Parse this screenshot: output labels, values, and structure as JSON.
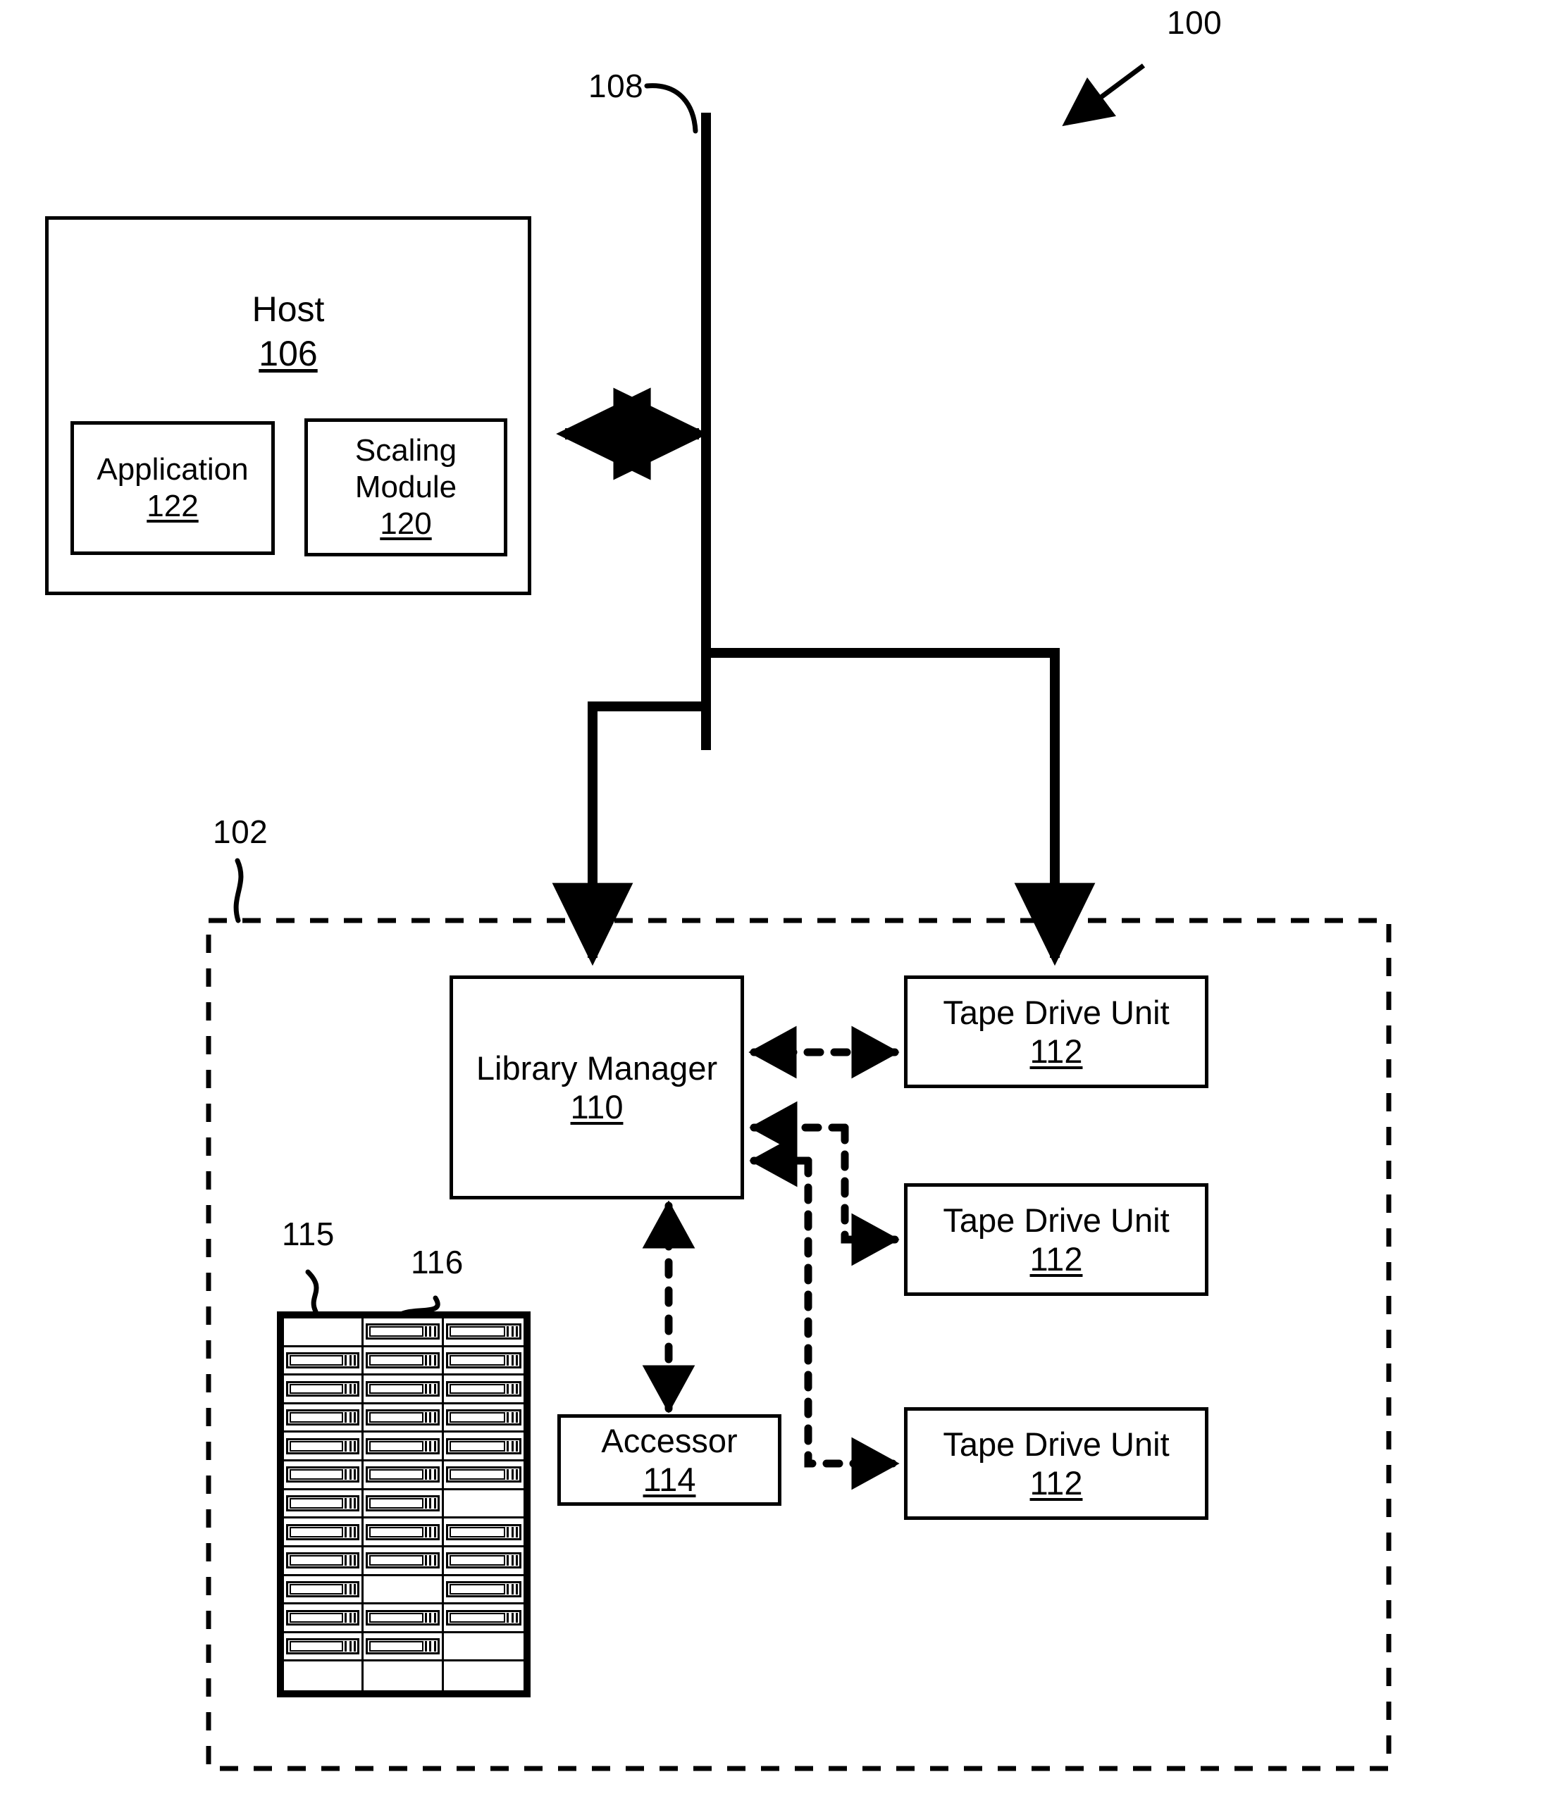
{
  "figure": {
    "system_ref": "100",
    "library_ref": "102",
    "bus_ref": "108"
  },
  "host": {
    "title": "Host",
    "ref": "106",
    "application": {
      "title": "Application",
      "ref": "122"
    },
    "scaling_module": {
      "title_line1": "Scaling",
      "title_line2": "Module",
      "ref": "120"
    }
  },
  "library": {
    "ref": "102",
    "manager": {
      "title": "Library Manager",
      "ref": "110"
    },
    "accessor": {
      "title": "Accessor",
      "ref": "114"
    },
    "tape_drives": [
      {
        "title": "Tape Drive Unit",
        "ref": "112"
      },
      {
        "title": "Tape Drive Unit",
        "ref": "112"
      },
      {
        "title": "Tape Drive Unit",
        "ref": "112"
      }
    ],
    "magazine": {
      "rack_ref": "115",
      "slot_ref": "116",
      "rows": 13,
      "columns": 3,
      "occupancy": [
        [
          0,
          1,
          1
        ],
        [
          1,
          1,
          1
        ],
        [
          1,
          1,
          1
        ],
        [
          1,
          1,
          1
        ],
        [
          1,
          1,
          1
        ],
        [
          1,
          1,
          1
        ],
        [
          1,
          1,
          0
        ],
        [
          1,
          1,
          1
        ],
        [
          1,
          1,
          1
        ],
        [
          1,
          0,
          1
        ],
        [
          1,
          1,
          1
        ],
        [
          1,
          1,
          0
        ],
        [
          0,
          0,
          0
        ]
      ]
    }
  },
  "colors": {
    "ink": "#000000",
    "paper": "#ffffff"
  }
}
